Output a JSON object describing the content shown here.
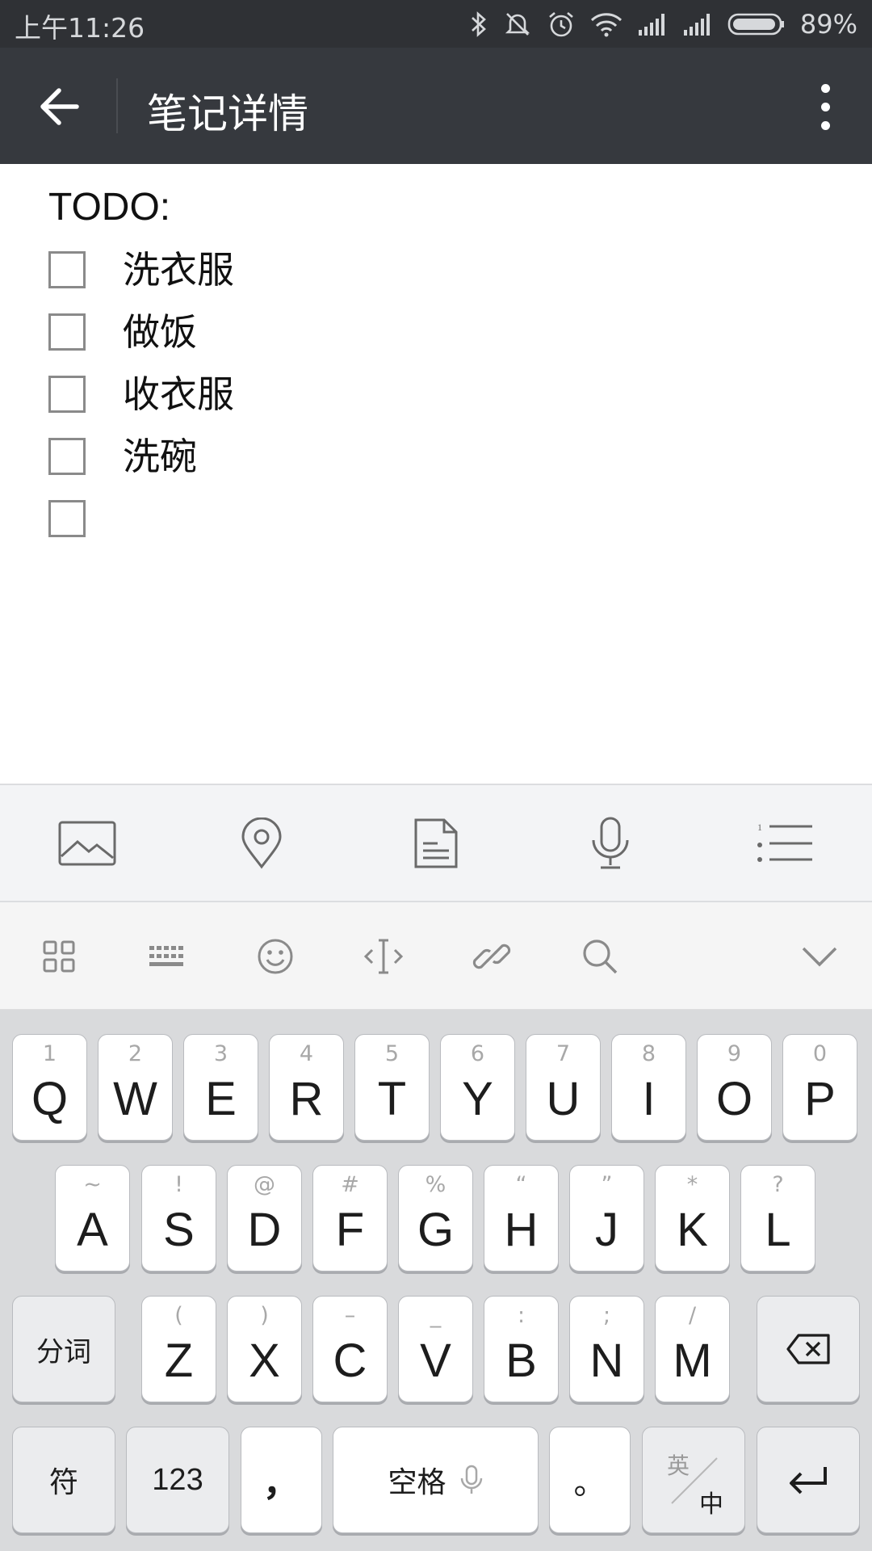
{
  "status_bar": {
    "time": "上午11:26",
    "battery_percent": "89%",
    "icons": [
      "bluetooth-icon",
      "mute-icon",
      "alarm-icon",
      "wifi-icon",
      "signal-icon",
      "signal-icon",
      "battery-icon"
    ]
  },
  "app_bar": {
    "title": "笔记详情",
    "back_icon": "back-arrow-icon",
    "menu_icon": "more-vertical-icon"
  },
  "note": {
    "heading": "TODO:",
    "items": [
      {
        "text": "洗衣服",
        "checked": false
      },
      {
        "text": "做饭",
        "checked": false
      },
      {
        "text": "收衣服",
        "checked": false
      },
      {
        "text": "洗碗",
        "checked": false
      },
      {
        "text": "",
        "checked": false
      }
    ]
  },
  "note_toolbar": {
    "icons": [
      "image-icon",
      "location-icon",
      "document-icon",
      "microphone-icon",
      "list-icon"
    ]
  },
  "keyboard_strip": {
    "icons": [
      "grid-icon",
      "keyboard-icon",
      "emoji-icon",
      "cursor-icon",
      "link-icon",
      "search-icon",
      "chevron-down-icon"
    ]
  },
  "keyboard": {
    "row1": [
      {
        "sub": "1",
        "key": "Q"
      },
      {
        "sub": "2",
        "key": "W"
      },
      {
        "sub": "3",
        "key": "E"
      },
      {
        "sub": "4",
        "key": "R"
      },
      {
        "sub": "5",
        "key": "T"
      },
      {
        "sub": "6",
        "key": "Y"
      },
      {
        "sub": "7",
        "key": "U"
      },
      {
        "sub": "8",
        "key": "I"
      },
      {
        "sub": "9",
        "key": "O"
      },
      {
        "sub": "0",
        "key": "P"
      }
    ],
    "row2": [
      {
        "sub": "~",
        "key": "A"
      },
      {
        "sub": "!",
        "key": "S"
      },
      {
        "sub": "@",
        "key": "D"
      },
      {
        "sub": "#",
        "key": "F"
      },
      {
        "sub": "%",
        "key": "G"
      },
      {
        "sub": "“",
        "key": "H"
      },
      {
        "sub": "”",
        "key": "J"
      },
      {
        "sub": "*",
        "key": "K"
      },
      {
        "sub": "?",
        "key": "L"
      }
    ],
    "row3": [
      {
        "sub": "(",
        "key": "Z"
      },
      {
        "sub": ")",
        "key": "X"
      },
      {
        "sub": "–",
        "key": "C"
      },
      {
        "sub": "_",
        "key": "V"
      },
      {
        "sub": ":",
        "key": "B"
      },
      {
        "sub": ";",
        "key": "N"
      },
      {
        "sub": "/",
        "key": "M"
      }
    ],
    "segment_label": "分词",
    "symbol_label": "符",
    "number_label": "123",
    "comma_label": "，",
    "space_label": "空格",
    "period_label": "。",
    "lang_top": "英",
    "lang_bottom": "中"
  }
}
